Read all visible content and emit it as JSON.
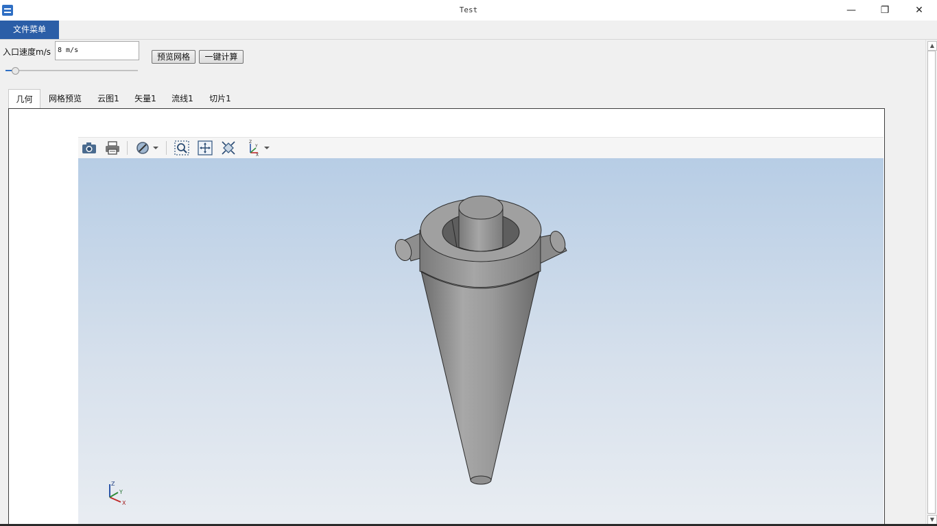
{
  "window": {
    "title": "Test",
    "minimize_label": "—",
    "restore_label": "❐",
    "close_label": "✕"
  },
  "menu": {
    "file_label": "文件菜单"
  },
  "controls": {
    "speed_label": "入口速度m/s",
    "speed_value": "8 m/s",
    "preview_button": "预览网格",
    "compute_button": "一键计算",
    "slider_fraction": 0.07
  },
  "tabs": [
    {
      "label": "几何",
      "active": true
    },
    {
      "label": "网格预览",
      "active": false
    },
    {
      "label": "云图1",
      "active": false
    },
    {
      "label": "矢量1",
      "active": false
    },
    {
      "label": "流线1",
      "active": false
    },
    {
      "label": "切片1",
      "active": false
    }
  ],
  "toolbar": {
    "icons": [
      "camera-icon",
      "print-icon",
      "clip-plane-icon",
      "dropdown-arrow-icon",
      "zoom-region-icon",
      "fit-all-icon",
      "reset-view-icon",
      "axes-orientation-icon",
      "dropdown-arrow-icon"
    ]
  },
  "viewport": {
    "model": "cyclone-separator",
    "axes": {
      "z": "Z",
      "y": "Y",
      "x": "X"
    },
    "bg_top": "#b7cde5",
    "bg_bottom": "#e9edf2",
    "model_color": "#9a9a9a"
  },
  "colors": {
    "menu_accent": "#2b5ea7",
    "slider_accent": "#2f6fc4"
  }
}
